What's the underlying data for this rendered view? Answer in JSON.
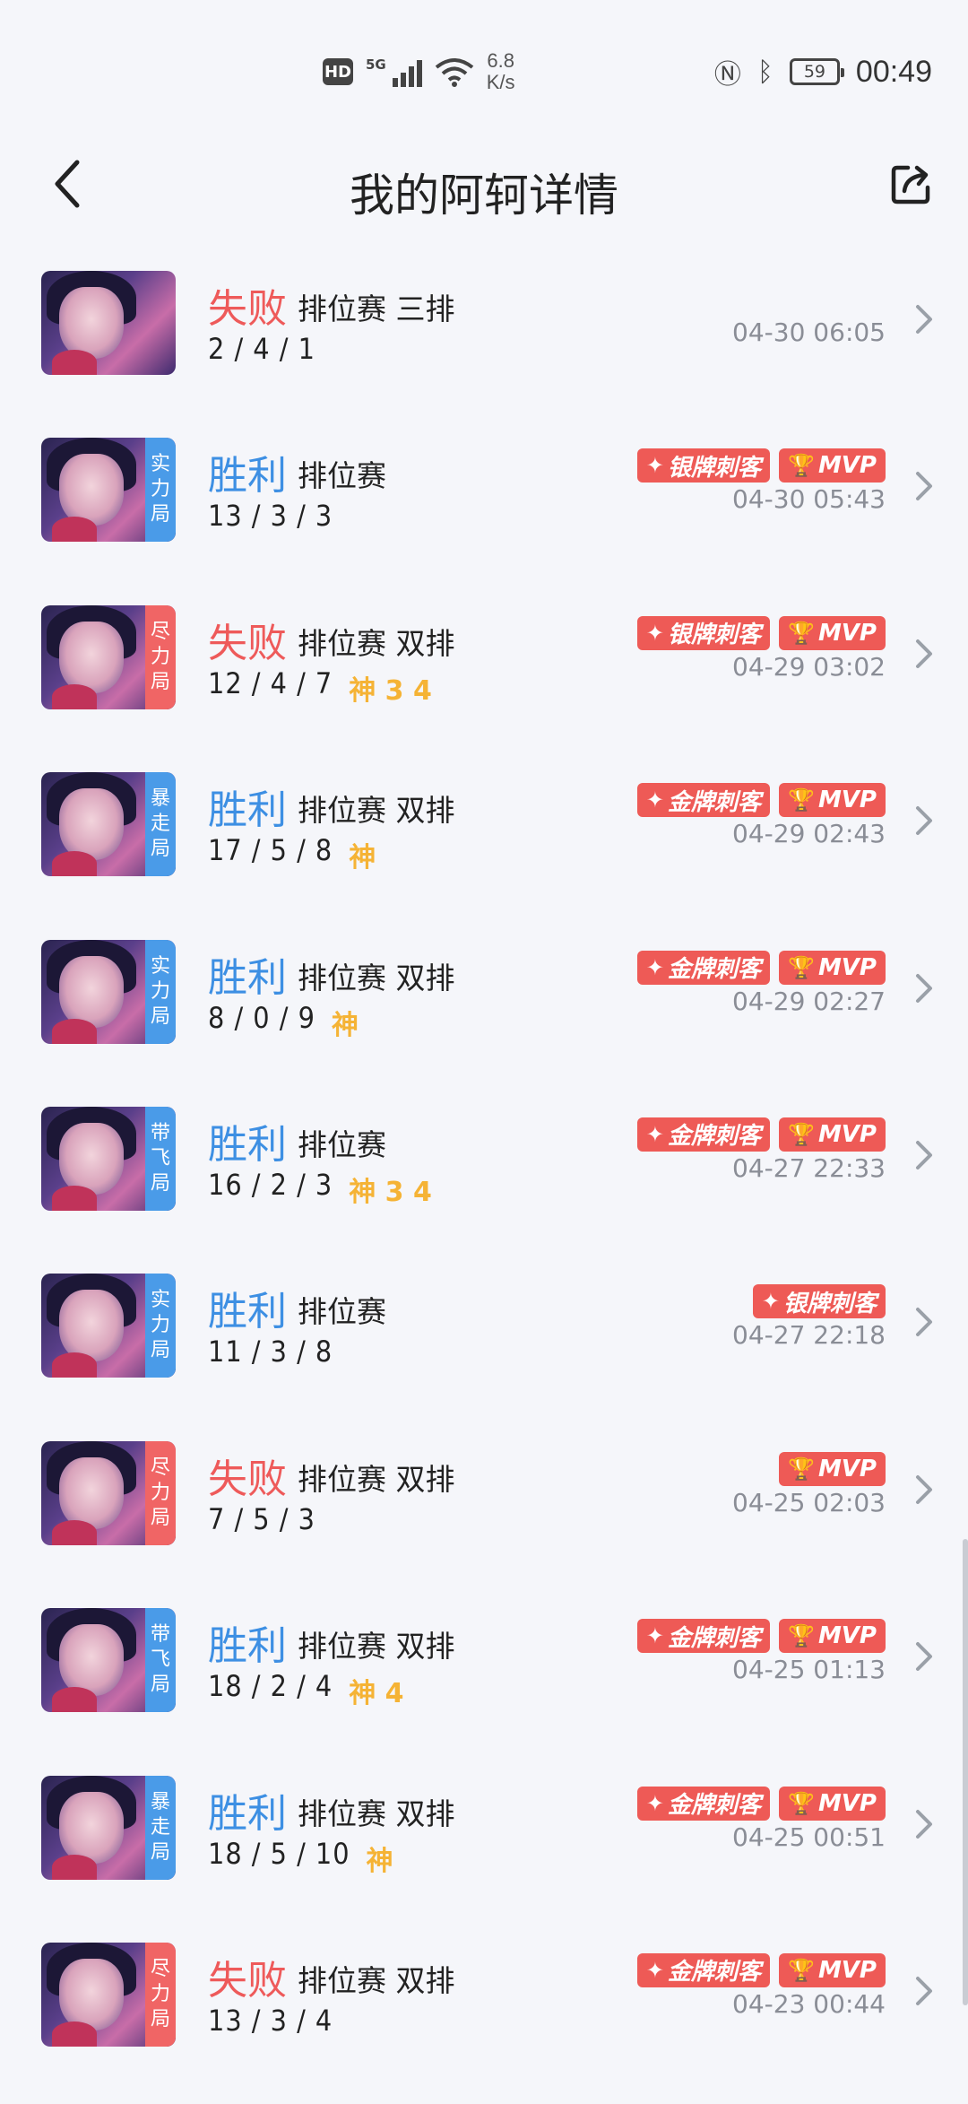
{
  "status_bar": {
    "hd": "HD",
    "network": "5G",
    "speed_value": "6.8",
    "speed_unit": "K/s",
    "battery": "59",
    "time": "00:49"
  },
  "header": {
    "title": "我的阿轲详情"
  },
  "matches": [
    {
      "result": "失败",
      "mode": "排位赛 三排",
      "kda": "2 / 4 / 1",
      "god": "",
      "tag": "",
      "badges": [],
      "time": "04-30 06:05"
    },
    {
      "result": "胜利",
      "mode": "排位赛",
      "kda": "13 / 3 / 3",
      "god": "",
      "tag": "实力局",
      "badges": [
        "银牌刺客",
        "MVP"
      ],
      "time": "04-30 05:43"
    },
    {
      "result": "失败",
      "mode": "排位赛 双排",
      "kda": "12 / 4 / 7",
      "god": "神 3 4",
      "tag": "尽力局",
      "badges": [
        "银牌刺客",
        "MVP"
      ],
      "time": "04-29 03:02"
    },
    {
      "result": "胜利",
      "mode": "排位赛 双排",
      "kda": "17 / 5 / 8",
      "god": "神",
      "tag": "暴走局",
      "badges": [
        "金牌刺客",
        "MVP"
      ],
      "time": "04-29 02:43"
    },
    {
      "result": "胜利",
      "mode": "排位赛 双排",
      "kda": "8 / 0 / 9",
      "god": "神",
      "tag": "实力局",
      "badges": [
        "金牌刺客",
        "MVP"
      ],
      "time": "04-29 02:27"
    },
    {
      "result": "胜利",
      "mode": "排位赛",
      "kda": "16 / 2 / 3",
      "god": "神 3 4",
      "tag": "带飞局",
      "badges": [
        "金牌刺客",
        "MVP"
      ],
      "time": "04-27 22:33"
    },
    {
      "result": "胜利",
      "mode": "排位赛",
      "kda": "11 / 3 / 8",
      "god": "",
      "tag": "实力局",
      "badges": [
        "银牌刺客"
      ],
      "time": "04-27 22:18"
    },
    {
      "result": "失败",
      "mode": "排位赛 双排",
      "kda": "7 / 5 / 3",
      "god": "",
      "tag": "尽力局",
      "badges": [
        "MVP"
      ],
      "time": "04-25 02:03"
    },
    {
      "result": "胜利",
      "mode": "排位赛 双排",
      "kda": "18 / 2 / 4",
      "god": "神 4",
      "tag": "带飞局",
      "badges": [
        "金牌刺客",
        "MVP"
      ],
      "time": "04-25 01:13"
    },
    {
      "result": "胜利",
      "mode": "排位赛 双排",
      "kda": "18 / 5 / 10",
      "god": "神",
      "tag": "暴走局",
      "badges": [
        "金牌刺客",
        "MVP"
      ],
      "time": "04-25 00:51"
    },
    {
      "result": "失败",
      "mode": "排位赛 双排",
      "kda": "13 / 3 / 4",
      "god": "",
      "tag": "尽力局",
      "badges": [
        "金牌刺客",
        "MVP"
      ],
      "time": "04-23 00:44"
    }
  ],
  "colors": {
    "win": "#3d8fe3",
    "lose": "#ee5a5a",
    "god": "#f5b335",
    "badge": "#ee5a56"
  }
}
